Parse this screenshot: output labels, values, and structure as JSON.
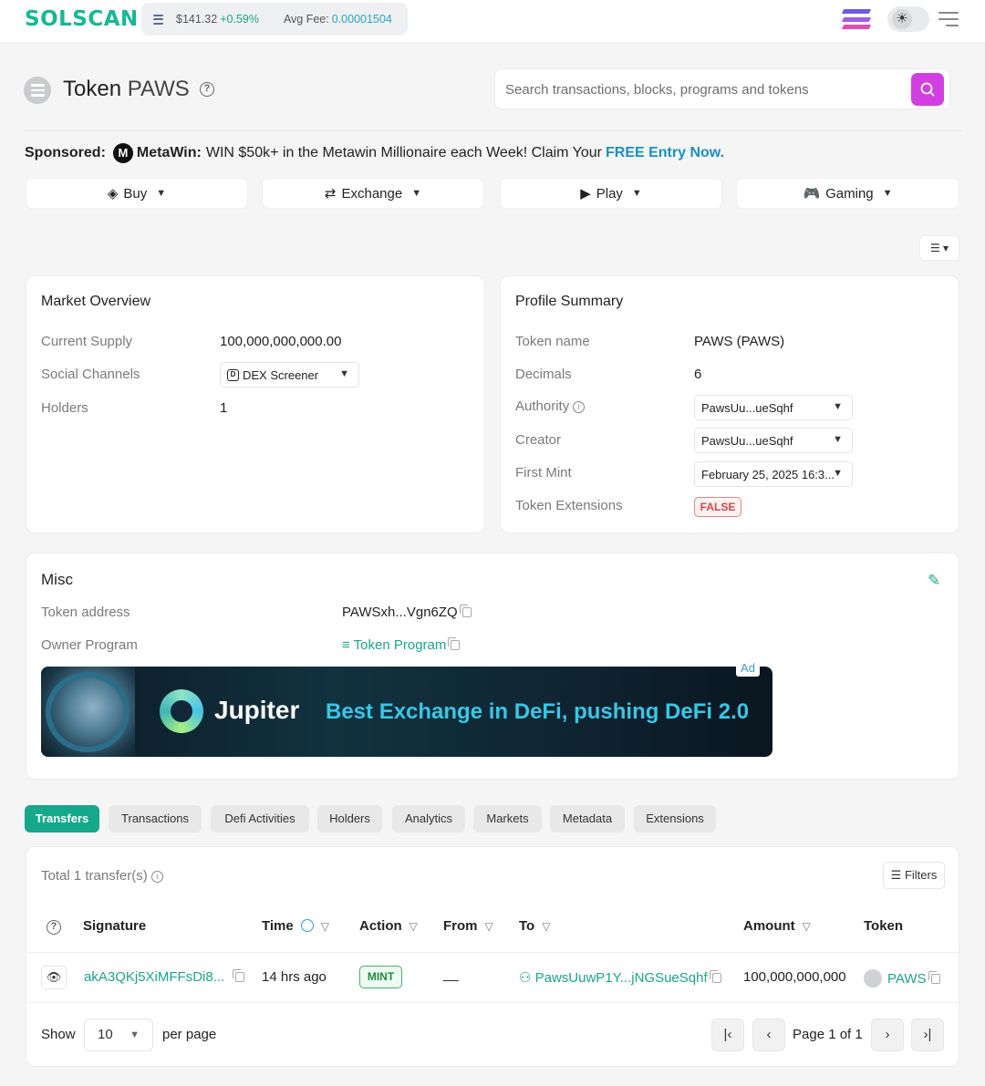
{
  "header": {
    "logo": "SOLSCAN",
    "sol_price": "$141.32",
    "sol_change": "+0.59%",
    "avg_fee_label": "Avg Fee:",
    "avg_fee_value": "0.00001504",
    "theme_icon": "sun-icon",
    "menu_icon": "menu-icon"
  },
  "page": {
    "title_prefix": "Token",
    "title_symbol": "PAWS",
    "help_glyph": "?"
  },
  "search": {
    "placeholder": "Search transactions, blocks, programs and tokens"
  },
  "sponsored": {
    "label": "Sponsored:",
    "brand": "MetaWin:",
    "text": "WIN $50k+ in the Metawin Millionaire each Week! Claim Your",
    "cta": "FREE Entry Now."
  },
  "quick_actions": [
    "Buy",
    "Exchange",
    "Play",
    "Gaming"
  ],
  "market_overview": {
    "title": "Market Overview",
    "rows": [
      {
        "label": "Current Supply",
        "value": "100,000,000,000.00"
      },
      {
        "label": "Social Channels",
        "value": "DEX Screener"
      },
      {
        "label": "Holders",
        "value": "1"
      }
    ]
  },
  "profile_summary": {
    "title": "Profile Summary",
    "token_name_label": "Token name",
    "token_name": "PAWS (PAWS)",
    "decimals_label": "Decimals",
    "decimals": "6",
    "authority_label": "Authority",
    "authority": "PawsUu...ueSqhf",
    "creator_label": "Creator",
    "creator": "PawsUu...ueSqhf",
    "first_mint_label": "First Mint",
    "first_mint": "February 25, 2025 16:3...",
    "extensions_label": "Token Extensions",
    "extensions": "FALSE"
  },
  "misc": {
    "title": "Misc",
    "token_address_label": "Token address",
    "token_address": "PAWSxh...Vgn6ZQ",
    "owner_program_label": "Owner Program",
    "owner_program": "Token Program"
  },
  "ad": {
    "tag": "Ad",
    "brand": "Jupiter",
    "tagline": "Best Exchange in DeFi, pushing DeFi 2.0"
  },
  "tabs": [
    "Transfers",
    "Transactions",
    "Defi Activities",
    "Holders",
    "Analytics",
    "Markets",
    "Metadata",
    "Extensions"
  ],
  "transfers": {
    "total": "Total 1 transfer(s)",
    "filters_label": "Filters",
    "columns": [
      "Signature",
      "Time",
      "Action",
      "From",
      "To",
      "Amount",
      "Token"
    ],
    "rows": [
      {
        "signature": "akA3QKj5XiMFFsDi8...",
        "time": "14 hrs ago",
        "action": "MINT",
        "from": "__",
        "to": "PawsUuwP1Y...jNGSueSqhf",
        "amount": "100,000,000,000",
        "token": "PAWS"
      }
    ],
    "show_label": "Show",
    "per_page_value": "10",
    "per_page_label": "per page",
    "page_info": "Page 1 of 1"
  },
  "colors": {
    "brand": "#16b895",
    "accent_purple": "#d23fe0",
    "link": "#1ba58a",
    "positive": "#1fa97a",
    "danger": "#d24848"
  }
}
